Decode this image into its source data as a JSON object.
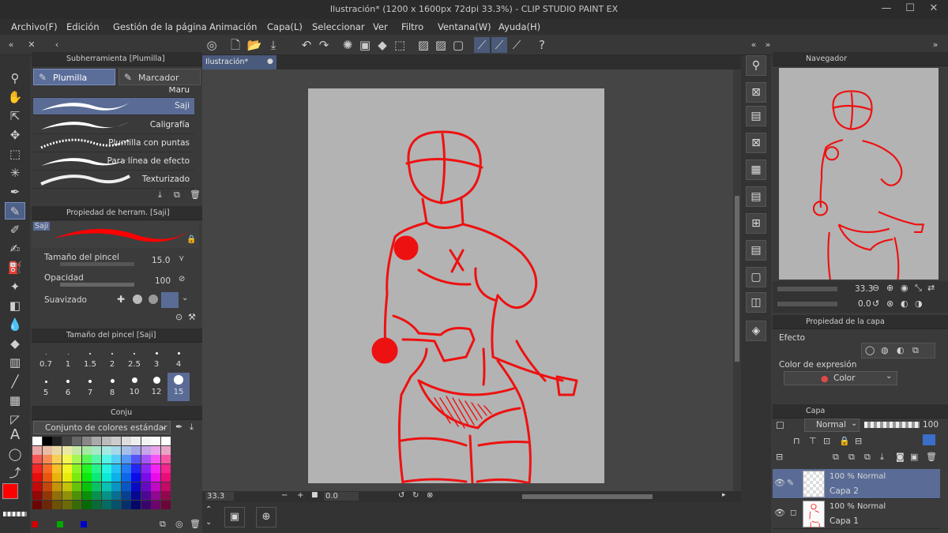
{
  "window": {
    "title": "Ilustración* (1200 x 1600px 72dpi 33.3%)  - CLIP STUDIO PAINT EX",
    "min": "—",
    "max": "☐",
    "close": "✕"
  },
  "menu": [
    "Archivo(F)",
    "Edición",
    "Gestión de la página",
    "Animación",
    "Capa(L)",
    "Seleccionar",
    "Ver",
    "Filtro",
    "Ventana(W)",
    "Ayuda(H)"
  ],
  "subtool_panel": {
    "title": "Subherramienta [Plumilla]",
    "tabs": [
      "Plumilla",
      "Marcador"
    ],
    "items": [
      "Maru",
      "Saji",
      "Caligrafía",
      "Plumilla con puntas",
      "Para línea de efecto",
      "Texturizado"
    ]
  },
  "tool_property": {
    "title": "Propiedad de herram. [Saji]",
    "preview_label": "Saji",
    "brush_size_label": "Tamaño del pincel",
    "brush_size_value": "15.0",
    "opacity_label": "Opacidad",
    "opacity_value": "100",
    "smoothing_label": "Suavizado"
  },
  "brush_size_panel": {
    "title": "Tamaño del pincel [Saji]",
    "sizes": [
      "0.7",
      "1",
      "1.5",
      "2",
      "2.5",
      "3",
      "4",
      "5",
      "6",
      "7",
      "8",
      "10",
      "12",
      "15"
    ],
    "selected": "15"
  },
  "color_set": {
    "tab": "Conju",
    "set_name": "Conjunto de colores estándar",
    "main_color": "#ff0000",
    "sub_color": "#ffffff"
  },
  "canvas": {
    "tab": "Ilustración*",
    "zoom": "33.3",
    "rotation": "0.0",
    "line_color": "#ee1111",
    "paper_color": "#b3b3b3"
  },
  "navigator": {
    "title": "Navegador",
    "zoom": "33.3",
    "angle": "0.0"
  },
  "layer_property": {
    "title": "Propiedad de la capa",
    "effect_label": "Efecto",
    "expression_label": "Color de expresión",
    "expression_value": "Color"
  },
  "layers": {
    "title": "Capa",
    "blend": "Normal",
    "opacity": "100",
    "items": [
      {
        "mode": "100 % Normal",
        "name": "Capa 2",
        "selected": true
      },
      {
        "mode": "100 % Normal",
        "name": "Capa 1",
        "selected": false
      }
    ]
  }
}
